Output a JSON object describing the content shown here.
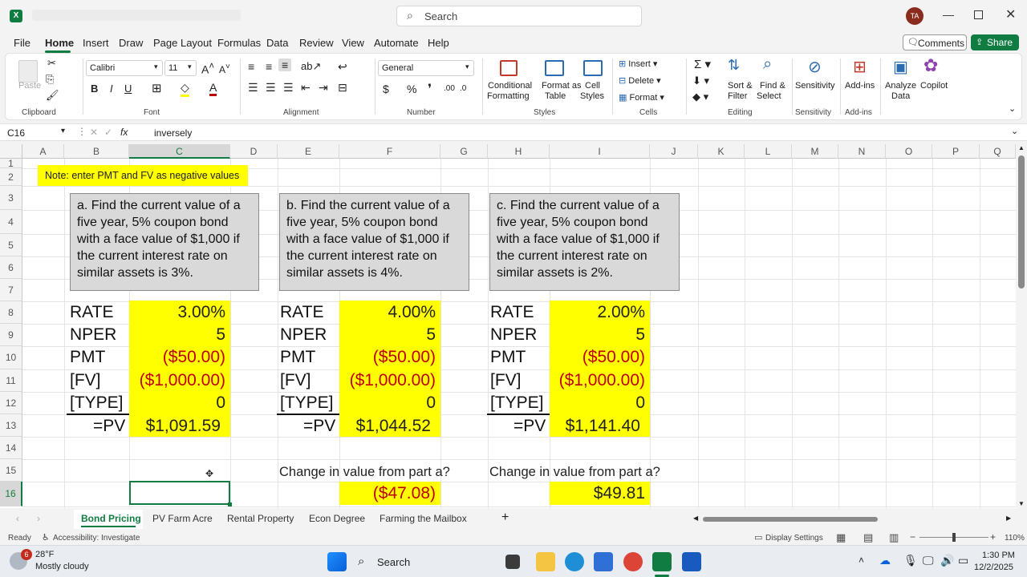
{
  "titlebar": {
    "search_placeholder": "Search",
    "avatar_initials": "TA"
  },
  "menu": [
    "File",
    "Home",
    "Insert",
    "Draw",
    "Page Layout",
    "Formulas",
    "Data",
    "Review",
    "View",
    "Automate",
    "Help"
  ],
  "actions": {
    "comments": "Comments",
    "share": "Share"
  },
  "ribbon": {
    "clipboard": {
      "paste": "Paste",
      "group": "Clipboard"
    },
    "font": {
      "name": "Calibri",
      "size": "11",
      "group": "Font"
    },
    "alignment": {
      "group": "Alignment"
    },
    "number": {
      "format": "General",
      "group": "Number"
    },
    "styles": {
      "conditional": "Conditional",
      "formatting": "Formatting",
      "format_as": "Format as",
      "table": "Table",
      "cell": "Cell",
      "styles_label": "Styles",
      "group": "Styles"
    },
    "cells": {
      "insert": "Insert",
      "delete": "Delete",
      "format": "Format",
      "group": "Cells"
    },
    "editing": {
      "sort": "Sort &",
      "filter": "Filter",
      "find": "Find &",
      "select": "Select",
      "group": "Editing"
    },
    "sensitivity": {
      "label": "Sensitivity",
      "group": "Sensitivity"
    },
    "addins": {
      "label": "Add-ins",
      "group": "Add-ins"
    },
    "analyze": {
      "l1": "Analyze",
      "l2": "Data"
    },
    "copilot": "Copilot"
  },
  "formula_bar": {
    "name_box": "C16",
    "fx": "fx",
    "content": "inversely"
  },
  "columns": [
    "A",
    "B",
    "C",
    "D",
    "E",
    "F",
    "G",
    "H",
    "I",
    "J",
    "K",
    "L",
    "M",
    "N",
    "O",
    "P",
    "Q"
  ],
  "rows": [
    "1",
    "2",
    "3",
    "4",
    "5",
    "6",
    "7",
    "8",
    "9",
    "10",
    "11",
    "12",
    "13",
    "14",
    "15",
    "16"
  ],
  "note": "Note: enter PMT and FV as negative values",
  "problems": [
    {
      "text": "a. Find the current value of a five year, 5% coupon bond with a face value of $1,000 if the current interest rate on similar assets is 3%.",
      "rate": "3.00%",
      "nper": "5",
      "pmt": "($50.00)",
      "fv": "($1,000.00)",
      "type": "0",
      "pv": "$1,091.59"
    },
    {
      "text": "b. Find the current value of a five year, 5% coupon bond with a face value of $1,000 if the current interest rate on similar assets is 4%.",
      "rate": "4.00%",
      "nper": "5",
      "pmt": "($50.00)",
      "fv": "($1,000.00)",
      "type": "0",
      "pv": "$1,044.52",
      "change_label": "Change in value from part a?",
      "change_value": "($47.08)"
    },
    {
      "text": "c. Find the current value of a five year, 5% coupon bond with a face value of $1,000 if the current interest rate on similar assets is 2%.",
      "rate": "2.00%",
      "nper": "5",
      "pmt": "($50.00)",
      "fv": "($1,000.00)",
      "type": "0",
      "pv": "$1,141.40",
      "change_label": "Change in value from part a?",
      "change_value": "$49.81"
    }
  ],
  "labels": {
    "rate": "RATE",
    "nper": "NPER",
    "pmt": "PMT",
    "fv": "[FV]",
    "type": "[TYPE]",
    "pv": "=PV"
  },
  "sheets": [
    "Bond Pricing",
    "PV Farm Acre",
    "Rental Property",
    "Econ Degree",
    "Farming the Mailbox"
  ],
  "status": {
    "ready": "Ready",
    "accessibility": "Accessibility: Investigate",
    "display": "Display Settings",
    "zoom": "110%"
  },
  "taskbar": {
    "temp": "28°F",
    "weather": "Mostly cloudy",
    "search": "Search",
    "time": "1:30 PM",
    "date": "12/2/2025",
    "badge": "6"
  },
  "colors": {
    "excel_green": "#107c41",
    "highlight": "#ffff00",
    "negative": "#c00000"
  }
}
